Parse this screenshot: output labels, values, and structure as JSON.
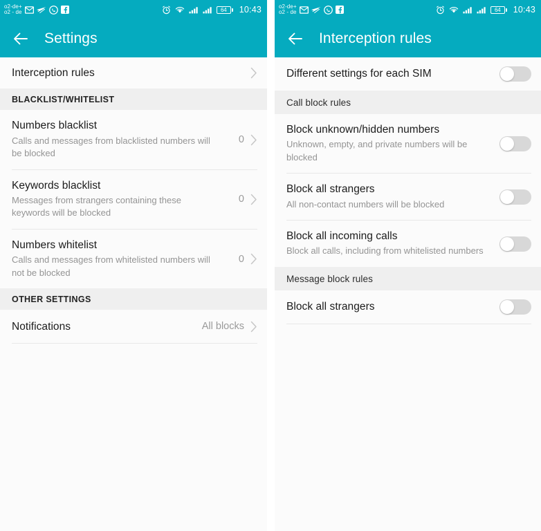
{
  "theme": {
    "accent": "#05ABBF",
    "page_bg": "#fbfbfb",
    "section_bg": "#efefef",
    "divider": "#e8e8e8",
    "title_color": "#1b1b1b",
    "subtitle_color": "#949494",
    "toggle_off_track": "#d8d8d8"
  },
  "status_bar": {
    "carrier_line1": "o2-de+",
    "carrier_line2": "o2 - de",
    "icons_left": [
      "mail-icon",
      "paper-plane-icon",
      "whatsapp-icon",
      "facebook-icon"
    ],
    "icons_right": [
      "alarm-icon",
      "wifi-icon",
      "signal-icon",
      "signal-icon"
    ],
    "battery_level": "64",
    "time": "10:43"
  },
  "left_screen": {
    "appbar": {
      "back_icon": "back-arrow-icon",
      "title": "Settings"
    },
    "top_row": {
      "title": "Interception rules",
      "chevron": "chevron-right-icon"
    },
    "sections": [
      {
        "header": "BLACKLIST/WHITELIST",
        "rows": [
          {
            "title": "Numbers blacklist",
            "subtitle": "Calls and messages from blacklisted numbers will be blocked",
            "value": "0",
            "chevron": "chevron-right-icon"
          },
          {
            "title": "Keywords blacklist",
            "subtitle": "Messages from strangers containing these keywords will be blocked",
            "value": "0",
            "chevron": "chevron-right-icon"
          },
          {
            "title": "Numbers whitelist",
            "subtitle": "Calls and messages from whitelisted numbers will not be blocked",
            "value": "0",
            "chevron": "chevron-right-icon"
          }
        ]
      },
      {
        "header": "OTHER SETTINGS",
        "rows": [
          {
            "title": "Notifications",
            "subtitle": "",
            "value": "All blocks",
            "chevron": "chevron-right-icon"
          }
        ]
      }
    ]
  },
  "right_screen": {
    "appbar": {
      "back_icon": "back-arrow-icon",
      "title": "Interception rules"
    },
    "top_row": {
      "title": "Different settings for each SIM",
      "toggle_state": "off"
    },
    "sections": [
      {
        "header": "Call block rules",
        "rows": [
          {
            "title": "Block unknown/hidden numbers",
            "subtitle": "Unknown, empty, and private numbers will be blocked",
            "toggle_state": "off"
          },
          {
            "title": "Block all strangers",
            "subtitle": "All non-contact numbers will be blocked",
            "toggle_state": "off"
          },
          {
            "title": "Block all incoming calls",
            "subtitle": "Block all calls, including from whitelisted numbers",
            "toggle_state": "off"
          }
        ]
      },
      {
        "header": "Message block rules",
        "rows": [
          {
            "title": "Block all strangers",
            "subtitle": "",
            "toggle_state": "off"
          }
        ]
      }
    ]
  }
}
